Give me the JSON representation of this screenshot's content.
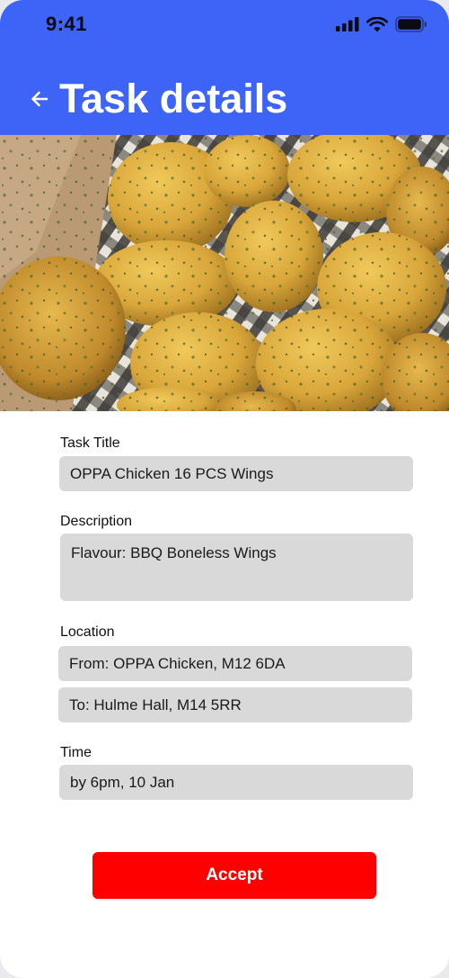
{
  "status_bar": {
    "time": "9:41"
  },
  "header": {
    "title": "Task details",
    "back_icon": "arrow-left-icon",
    "color": "#3d63f7"
  },
  "hero": {
    "alt": "Boneless fried chicken wings in a box"
  },
  "form": {
    "task_title_label": "Task Title",
    "task_title_value": "OPPA Chicken 16 PCS Wings",
    "description_label": "Description",
    "description_value": "Flavour: BBQ Boneless Wings",
    "location_label": "Location",
    "location_from": "From: OPPA Chicken, M12 6DA",
    "location_to": "To: Hulme Hall, M14 5RR",
    "time_label": "Time",
    "time_value": "by 6pm, 10 Jan"
  },
  "actions": {
    "accept_label": "Accept",
    "accept_color": "#ff0000"
  }
}
